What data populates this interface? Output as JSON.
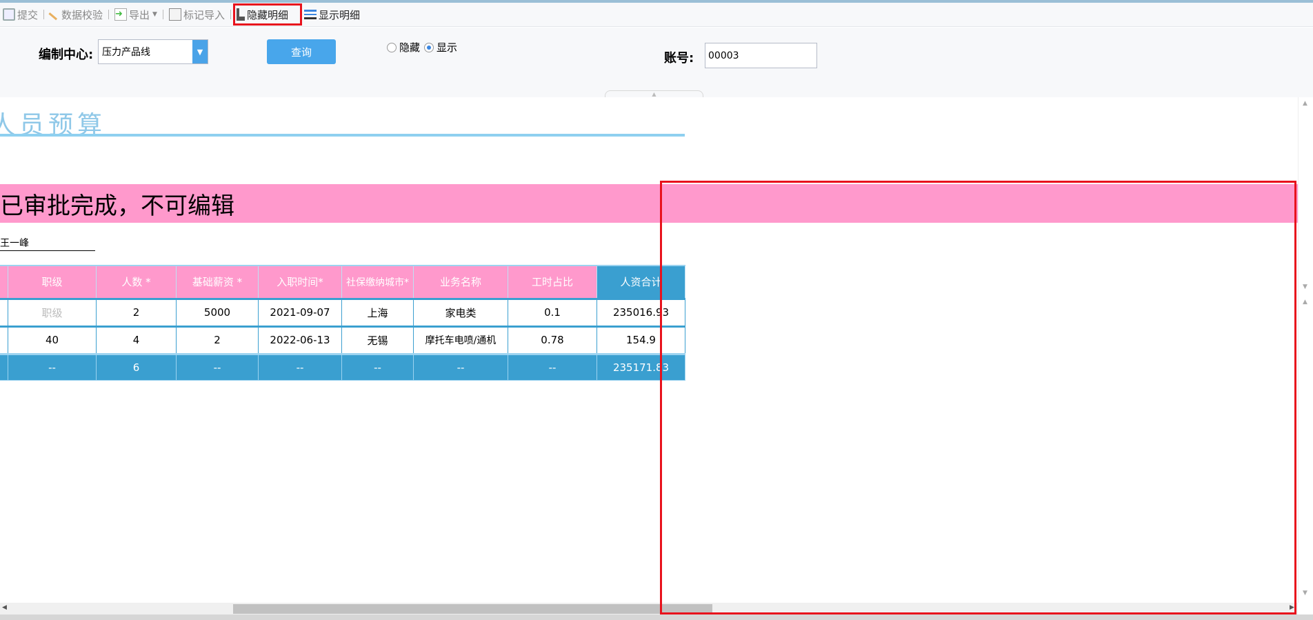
{
  "toolbar": {
    "items": [
      {
        "label": "提交",
        "icon": "save-icon"
      },
      {
        "label": "数据校验",
        "icon": "pencil-icon"
      },
      {
        "label": "导出",
        "icon": "export-icon"
      },
      {
        "label": "标记导入",
        "icon": "excel-import-icon"
      },
      {
        "label": "隐藏明细",
        "icon": "hide-detail-icon"
      },
      {
        "label": "显示明细",
        "icon": "list-icon"
      }
    ]
  },
  "form": {
    "center_label": "编制中心:",
    "center_value": "压力产品线",
    "query_label": "查询",
    "radio_hide": "隐藏",
    "radio_show": "显示",
    "radio_selected": "显示",
    "account_label": "账号:",
    "account_value": "00003"
  },
  "report": {
    "title": "人员预算",
    "banner": "已审批完成，不可编辑",
    "user": "王一峰"
  },
  "table": {
    "headers": [
      "职级",
      "人数 *",
      "基础薪资 *",
      "入职时间*",
      "社保缴纳城市*",
      "业务名称",
      "工时占比",
      "人资合计"
    ],
    "rows": [
      [
        "职级",
        "2",
        "5000",
        "2021-09-07",
        "上海",
        "家电类",
        "0.1",
        "235016.93"
      ],
      [
        "40",
        "4",
        "2",
        "2022-06-13",
        "无锡",
        "摩托车电喷/通机",
        "0.78",
        "154.9"
      ]
    ],
    "total": [
      "--",
      "6",
      "--",
      "--",
      "--",
      "--",
      "--",
      "235171.83"
    ]
  },
  "colors": {
    "header_pink": "#ff99cc",
    "accent_blue": "#3a9fd0",
    "banner": "#ff99cc",
    "annotation": "#e8121c"
  }
}
